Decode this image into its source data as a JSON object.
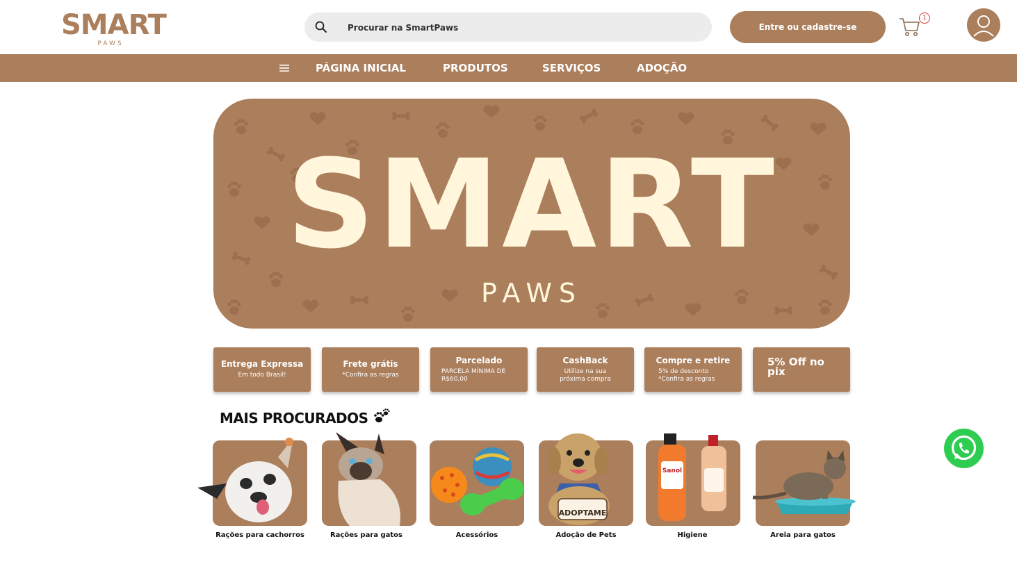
{
  "brand": {
    "name": "SMART",
    "sub": "PAWS",
    "color": "#ab7e5c",
    "cream": "#fff6dc"
  },
  "search": {
    "placeholder": "Procurar na SmartPaws",
    "icon": "search-icon"
  },
  "header": {
    "login_label": "Entre ou cadastre-se",
    "cart_count": "1",
    "cart_icon": "cart-icon",
    "user_icon": "user-icon"
  },
  "nav": {
    "menu_icon": "hamburger-icon",
    "items": [
      "PÁGINA INICIAL",
      "PRODUTOS",
      "SERVIÇOS",
      "ADOÇÃO"
    ]
  },
  "banner": {
    "title": "SMART",
    "subtitle": "PAWS"
  },
  "benefits": [
    {
      "title": "Entrega Expressa",
      "sub": "Em todo Brasil!"
    },
    {
      "title": "Frete grátis",
      "sub": "*Confira as regras"
    },
    {
      "title": "Parcelado",
      "sub": "PARCELA MÍNIMA DE R$60,00"
    },
    {
      "title": "CashBack",
      "sub": "Utilize na sua próxima compra"
    },
    {
      "title": "Compre e retire",
      "sub": "5% de desconto",
      "sub2": "*Confira as regras"
    },
    {
      "title": "5% Off no pix",
      "sub": ""
    }
  ],
  "section": {
    "title": "MAIS PROCURADOS"
  },
  "categories": [
    {
      "label": "Rações para cachorros"
    },
    {
      "label": "Rações para gatos"
    },
    {
      "label": "Acessórios"
    },
    {
      "label": "Adoção de Pets",
      "sign": "ADOPTAME"
    },
    {
      "label": "Higiene",
      "product": "Sanol"
    },
    {
      "label": "Areia para gatos"
    }
  ],
  "whatsapp": {
    "icon": "whatsapp-icon",
    "color": "#2ecc51"
  }
}
